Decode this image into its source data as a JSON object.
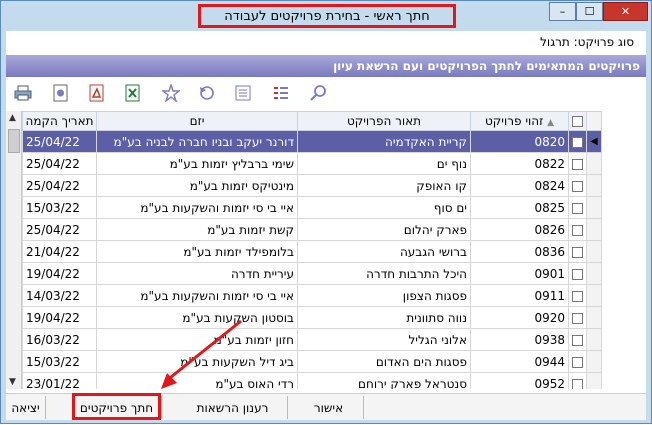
{
  "window": {
    "title": "חתך ראשי - בחירת פרויקטים לעבודה",
    "min": "–",
    "max": "☐",
    "close": "✕"
  },
  "project_type": "סוג פרויקט: תרגול",
  "banner": "פרויקטים המתאימים לחתך הפרויקטים ועם הרשאת עיון",
  "columns": {
    "date": "תאריך הקמה",
    "developer": "יזם",
    "description": "תאור הפרויקט",
    "number": "זהוי פרויקט"
  },
  "rows": [
    {
      "date": "25/04/22",
      "developer": "דורנר יעקב ובניו חברה לבניה בע\"מ",
      "description": "קריית האקדמיה",
      "number": "0820",
      "selected": true
    },
    {
      "date": "25/04/22",
      "developer": "שימי ברבליץ יזמות בע\"מ",
      "description": "נוף ים",
      "number": "0822"
    },
    {
      "date": "25/04/22",
      "developer": "מינטיקס יזמות בע\"מ",
      "description": "קו האופק",
      "number": "0824"
    },
    {
      "date": "15/03/22",
      "developer": "איי בי סי יזמות והשקעות בע\"מ",
      "description": "ים סוף",
      "number": "0825"
    },
    {
      "date": "25/04/22",
      "developer": "קשת יזמות בע\"מ",
      "description": "פארק יהלום",
      "number": "0826"
    },
    {
      "date": "21/04/22",
      "developer": "בלומפילד יזמות בע\"מ",
      "description": "ברושי הגבעה",
      "number": "0836"
    },
    {
      "date": "19/04/22",
      "developer": "עיריית חדרה",
      "description": "היכל התרבות חדרה",
      "number": "0901"
    },
    {
      "date": "14/03/22",
      "developer": "איי בי סי יזמות והשקעות בע\"מ",
      "description": "פסגות הצפון",
      "number": "0911"
    },
    {
      "date": "19/04/22",
      "developer": "בוסטון השקעות בע\"מ",
      "description": "נווה סתוונית",
      "number": "0920"
    },
    {
      "date": "16/03/22",
      "developer": "חזון יזמות בע\"מ",
      "description": "אלוני הגליל",
      "number": "0938"
    },
    {
      "date": "15/03/22",
      "developer": "ביג דיל השקעות בע\"מ",
      "description": "פסגות הים האדום",
      "number": "0944"
    },
    {
      "date": "23/01/22",
      "developer": "רדי האוס בע\"מ",
      "description": "סנטראל פארק ירוחם",
      "number": "0952"
    }
  ],
  "buttons": {
    "exit": "יציאה",
    "cross_section": "חתך פרויקטים",
    "refresh": "רענון הרשאות",
    "ok": "אישור"
  },
  "colors": {
    "highlight": "#e3161b",
    "selection": "#5c5fa6"
  }
}
